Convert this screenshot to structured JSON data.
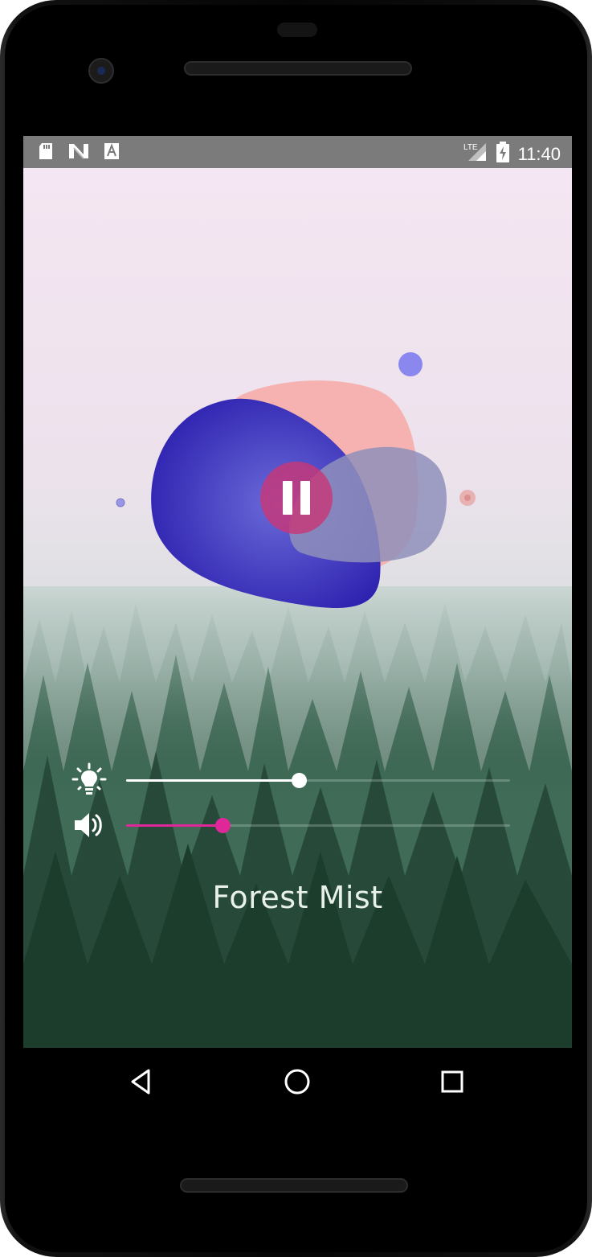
{
  "status_bar": {
    "time": "11:40",
    "network": "LTE",
    "left_icons": [
      "sd-card-icon",
      "n-logo-icon",
      "text-icon"
    ],
    "right_icons": [
      "lte-signal-icon",
      "battery-charging-icon"
    ]
  },
  "player": {
    "track_title": "Forest Mist",
    "state": "playing",
    "play_button_icon": "pause-icon"
  },
  "brightness": {
    "icon": "lightbulb-icon",
    "value": 0.45,
    "color": "#ffffff"
  },
  "volume": {
    "icon": "speaker-icon",
    "value": 0.25,
    "color": "#e0279a"
  },
  "blobs": {
    "colors": [
      "#3a33bb",
      "#f6a7a4",
      "#8f8fbb",
      "#8a88ee"
    ]
  },
  "nav_bar": {
    "buttons": [
      "back-icon",
      "home-icon",
      "recents-icon"
    ]
  }
}
